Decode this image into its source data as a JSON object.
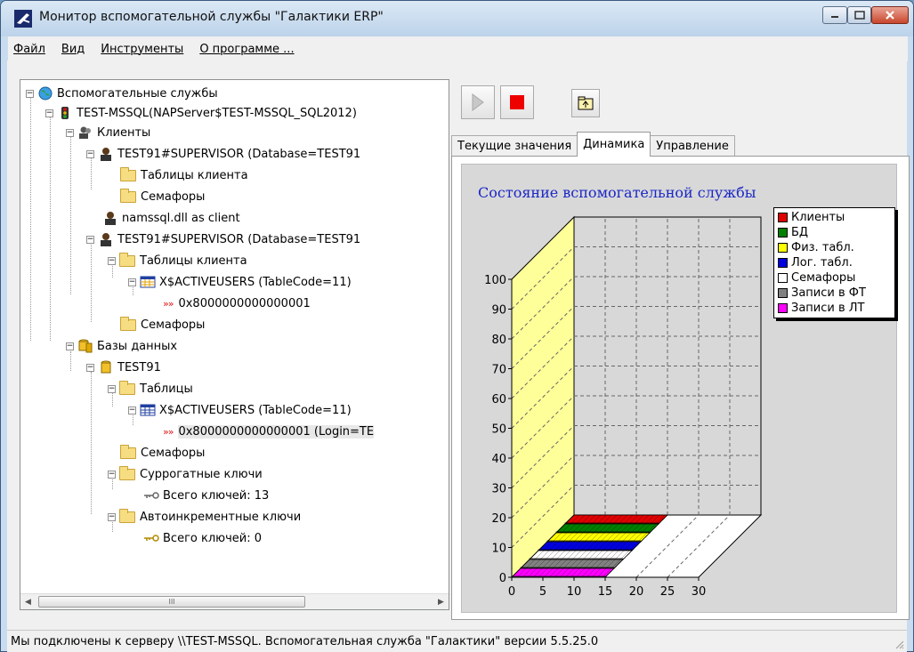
{
  "window": {
    "title": "Монитор вспомогательной службы \"Галактики ERP\""
  },
  "menu": [
    {
      "label": "Файл"
    },
    {
      "label": "Вид"
    },
    {
      "label": "Инструменты"
    },
    {
      "label": "О программе ..."
    }
  ],
  "tree": {
    "root": "Вспомогательные службы",
    "server": "TEST-MSSQL(NAPServer$TEST-MSSQL_SQL2012)",
    "clients_group": "Клиенты",
    "client1": "TEST91#SUPERVISOR (Database=TEST91",
    "client1_tables": "Таблицы клиента",
    "client1_semaphores": "Семафоры",
    "client2": "namssql.dll as client",
    "client3": "TEST91#SUPERVISOR (Database=TEST91",
    "client3_tables": "Таблицы клиента",
    "client3_table": "X$ACTIVEUSERS (TableCode=11)",
    "client3_record": "0x8000000000000001",
    "client3_semaphores": "Семафоры",
    "databases_group": "Базы данных",
    "db": "TEST91",
    "db_tables": "Таблицы",
    "db_table": "X$ACTIVEUSERS (TableCode=11)",
    "db_record": "0x8000000000000001 (Login=TE",
    "db_semaphores": "Семафоры",
    "surrogate_keys": "Суррогатные ключи",
    "surrogate_total": "Всего ключей: 13",
    "autoinc_keys": "Автоинкрементные ключи",
    "autoinc_total": "Всего ключей: 0"
  },
  "scrollbar": {
    "thumb_grip": "III"
  },
  "tabs": [
    {
      "label": "Текущие значения",
      "active": false
    },
    {
      "label": "Динамика",
      "active": true
    },
    {
      "label": "Управление",
      "active": false
    }
  ],
  "chart_data": {
    "type": "bar",
    "title": "Состояние вспомогательной службы",
    "x_ticks": [
      "0",
      "5",
      "10",
      "15",
      "20",
      "25",
      "30"
    ],
    "y_ticks": [
      "0",
      "10",
      "20",
      "30",
      "40",
      "50",
      "60",
      "70",
      "80",
      "90",
      "100"
    ],
    "xlim": [
      0,
      30
    ],
    "ylim": [
      0,
      100
    ],
    "style": "3d",
    "grid": true,
    "legend_position": "top-right",
    "series": [
      {
        "name": "Клиенты",
        "color": "#e00000",
        "values": [
          0
        ],
        "length": 15
      },
      {
        "name": "БД",
        "color": "#008000",
        "values": [
          0
        ],
        "length": 15
      },
      {
        "name": "Физ. табл.",
        "color": "#ffff00",
        "values": [
          0
        ],
        "length": 15
      },
      {
        "name": "Лог. табл.",
        "color": "#0000e0",
        "values": [
          0
        ],
        "length": 15
      },
      {
        "name": "Семафоры",
        "color": "#ffffff",
        "values": [
          0
        ],
        "length": 15
      },
      {
        "name": "Записи в ФТ",
        "color": "#808080",
        "values": [
          0
        ],
        "length": 15
      },
      {
        "name": "Записи в ЛТ",
        "color": "#ff00ff",
        "values": [
          0
        ],
        "length": 15
      }
    ]
  },
  "status": {
    "text": "Мы подключены к серверу \\\\TEST-MSSQL. Вспомогательная служба \"Галактики\" версии 5.5.25.0"
  }
}
